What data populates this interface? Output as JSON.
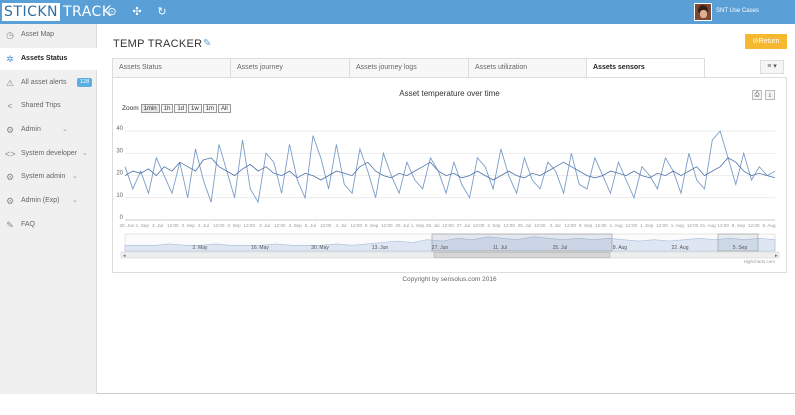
{
  "app": {
    "logo_left": "STICKN",
    "logo_right": "TRACK",
    "user_name": "SNT Use Cases"
  },
  "topbar_icons": [
    "play-circle-icon",
    "fullscreen-icon",
    "refresh-icon"
  ],
  "sidebar": {
    "items": [
      {
        "label": "Asset Map",
        "icon": "clock-icon"
      },
      {
        "label": "Assets Status",
        "icon": "spinner-icon",
        "active": true
      },
      {
        "label": "All asset alerts",
        "icon": "warning-icon",
        "badge": "128"
      },
      {
        "label": "Shared Trips",
        "icon": "share-icon"
      },
      {
        "label": "Admin",
        "icon": "gear-icon",
        "chevron": true
      },
      {
        "label": "System developer",
        "icon": "code-icon",
        "chevron": true
      },
      {
        "label": "System admin",
        "icon": "gear-icon",
        "chevron": true
      },
      {
        "label": "Admin (Exp)",
        "icon": "gears-icon",
        "chevron": true
      },
      {
        "label": "FAQ",
        "icon": "pencil-icon"
      }
    ]
  },
  "main": {
    "title": "TEMP TRACKER",
    "return_label": "⊘Return",
    "tabs": [
      {
        "label": "Assets Status"
      },
      {
        "label": "Assets journey"
      },
      {
        "label": "Assets journey logs"
      },
      {
        "label": "Assets utilization"
      },
      {
        "label": "Assets sensors",
        "active": true
      }
    ],
    "menu_label": "≡ ▾"
  },
  "chart_data": {
    "type": "line",
    "title": "Asset temperature over time",
    "zoom": {
      "label": "Zoom",
      "buttons": [
        "1min",
        "1h",
        "1d",
        "1w",
        "1m",
        "All"
      ],
      "selected": "1min"
    },
    "y_ticks": [
      0,
      10,
      20,
      30,
      40
    ],
    "ylim": [
      0,
      45
    ],
    "x_tick_labels": [
      "30. Jun",
      "1. Sep",
      "2. Jul",
      "12:00",
      "3. Sep",
      "2. Jul",
      "12:00",
      "3. Sep",
      "12:00",
      "3. Jul",
      "12:00",
      "3. Sep",
      "5. Jul",
      "12:00",
      "4. Jul",
      "12:00",
      "8. Sep",
      "12:00",
      "20. Jul",
      "1. Sep",
      "20. Jul",
      "12:00",
      "27. Jul",
      "12:00",
      "4. Sep",
      "12:00",
      "25. Jul",
      "12:00",
      "3. Jul",
      "12:00",
      "9. Sep",
      "12:00",
      "1. Aug",
      "12:00",
      "1. Sep",
      "12:00",
      "1. Aug",
      "12:00",
      "21. Aug",
      "12:00",
      "8. Sep",
      "12:00",
      "9. Aug"
    ],
    "navigator_labels": [
      "2. May",
      "16. May",
      "30. May",
      "13. Jun",
      "27. Jun",
      "11. Jul",
      "25. Jul",
      "8. Aug",
      "22. Aug",
      "5. Sep"
    ],
    "series": [
      {
        "name": "",
        "color": "#7a9cc8",
        "values": [
          24,
          14,
          22,
          12,
          28,
          20,
          12,
          26,
          10,
          32,
          18,
          8,
          34,
          22,
          10,
          36,
          14,
          8,
          30,
          26,
          12,
          34,
          18,
          10,
          38,
          28,
          14,
          34,
          16,
          12,
          32,
          22,
          10,
          30,
          20,
          12,
          26,
          18,
          14,
          28,
          22,
          12,
          26,
          16,
          10,
          28,
          24,
          14,
          32,
          20,
          12,
          28,
          18,
          14,
          26,
          22,
          12,
          30,
          16,
          14,
          28,
          20,
          12,
          26,
          18,
          10,
          24,
          20,
          14,
          28,
          22,
          12,
          30,
          18,
          14,
          36,
          40,
          28,
          16,
          30,
          18,
          24,
          20,
          22
        ]
      },
      {
        "name": "",
        "color": "#4f73a8",
        "values": [
          20,
          22,
          21,
          23,
          20,
          24,
          22,
          26,
          24,
          22,
          27,
          28,
          24,
          22,
          20,
          23,
          25,
          22,
          24,
          21,
          20,
          22,
          19,
          21,
          20,
          18,
          20,
          22,
          21,
          20,
          24,
          26,
          22,
          20,
          19,
          21,
          20,
          22,
          24,
          26,
          22,
          20,
          21,
          19,
          20,
          22,
          20,
          18,
          20,
          22,
          20,
          19,
          21,
          20,
          22,
          24,
          26,
          24,
          22,
          20,
          19,
          20,
          22,
          21,
          20,
          22,
          20,
          19,
          21,
          20,
          22,
          20,
          22,
          24,
          20,
          22,
          24,
          28,
          26,
          22,
          20,
          21,
          20,
          19
        ]
      }
    ],
    "navigator_values": [
      4,
      4,
      4,
      5,
      4,
      4,
      5,
      4,
      4,
      4,
      5,
      4,
      4,
      4,
      5,
      4,
      5,
      6,
      7,
      6,
      8,
      7,
      9,
      8,
      10,
      9,
      8,
      10,
      9,
      8,
      9,
      8,
      9,
      8,
      7,
      8,
      7,
      8,
      9,
      8,
      9,
      8,
      9,
      8
    ]
  },
  "footer": {
    "copyright": "Copyright by sensolus.com 2016"
  },
  "credit": "Highcharts.com"
}
